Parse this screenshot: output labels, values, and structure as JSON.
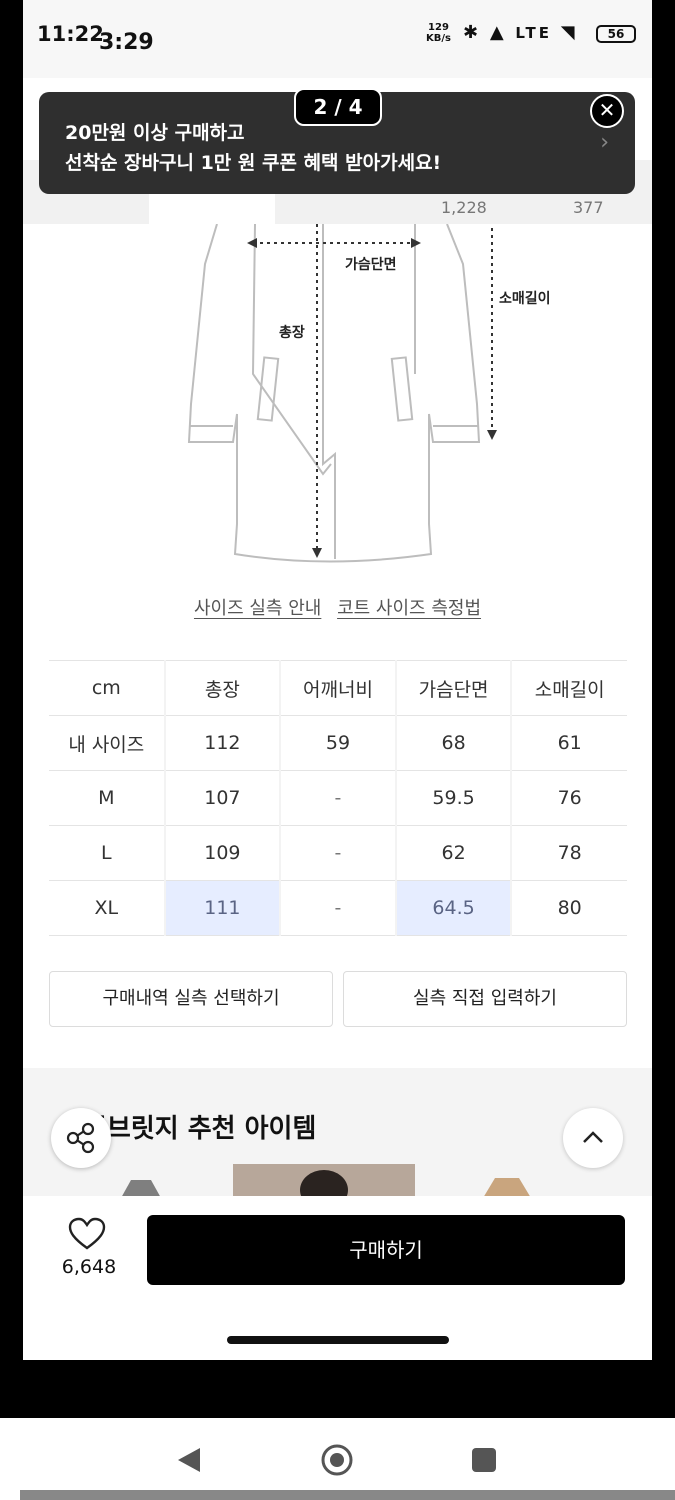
{
  "status_bar": {
    "time": "11:22",
    "time_overlay": "3:29",
    "speed_value": "129",
    "speed_unit": "KB/s",
    "network": "LTE",
    "battery": "56"
  },
  "toast": {
    "pager": "2 / 4",
    "line1": "20만원 이상 구매하고",
    "line2": "선착순 장바구니 1만 원 쿠폰 혜택 받아가세요!"
  },
  "tabs": {
    "counts": [
      "1,228",
      "377"
    ]
  },
  "diagram": {
    "labels": {
      "chest": "가슴단면",
      "sleeve": "소매길이",
      "length": "총장"
    }
  },
  "guide_links": {
    "size_guide": "사이즈 실측 안내",
    "coat_measure": "코트 사이즈 측정법"
  },
  "size_table": {
    "headers": [
      "cm",
      "총장",
      "어깨너비",
      "가슴단면",
      "소매길이"
    ],
    "rows": [
      [
        "내 사이즈",
        "112",
        "59",
        "68",
        "61"
      ],
      [
        "M",
        "107",
        "-",
        "59.5",
        "76"
      ],
      [
        "L",
        "109",
        "-",
        "62",
        "78"
      ],
      [
        "XL",
        "111",
        "-",
        "64.5",
        "80"
      ]
    ]
  },
  "buttons": {
    "purchase_history": "구매내역 실측 선택하기",
    "direct_input": "실측 직접 입력하기",
    "buy": "구매하기"
  },
  "recommend": {
    "title": "폴브릿지 추천 아이템"
  },
  "likes": {
    "count": "6,648"
  },
  "colors": {
    "highlight": "#e6edff",
    "toast_bg": "#2f2f2f",
    "buy_bg": "#000000"
  }
}
